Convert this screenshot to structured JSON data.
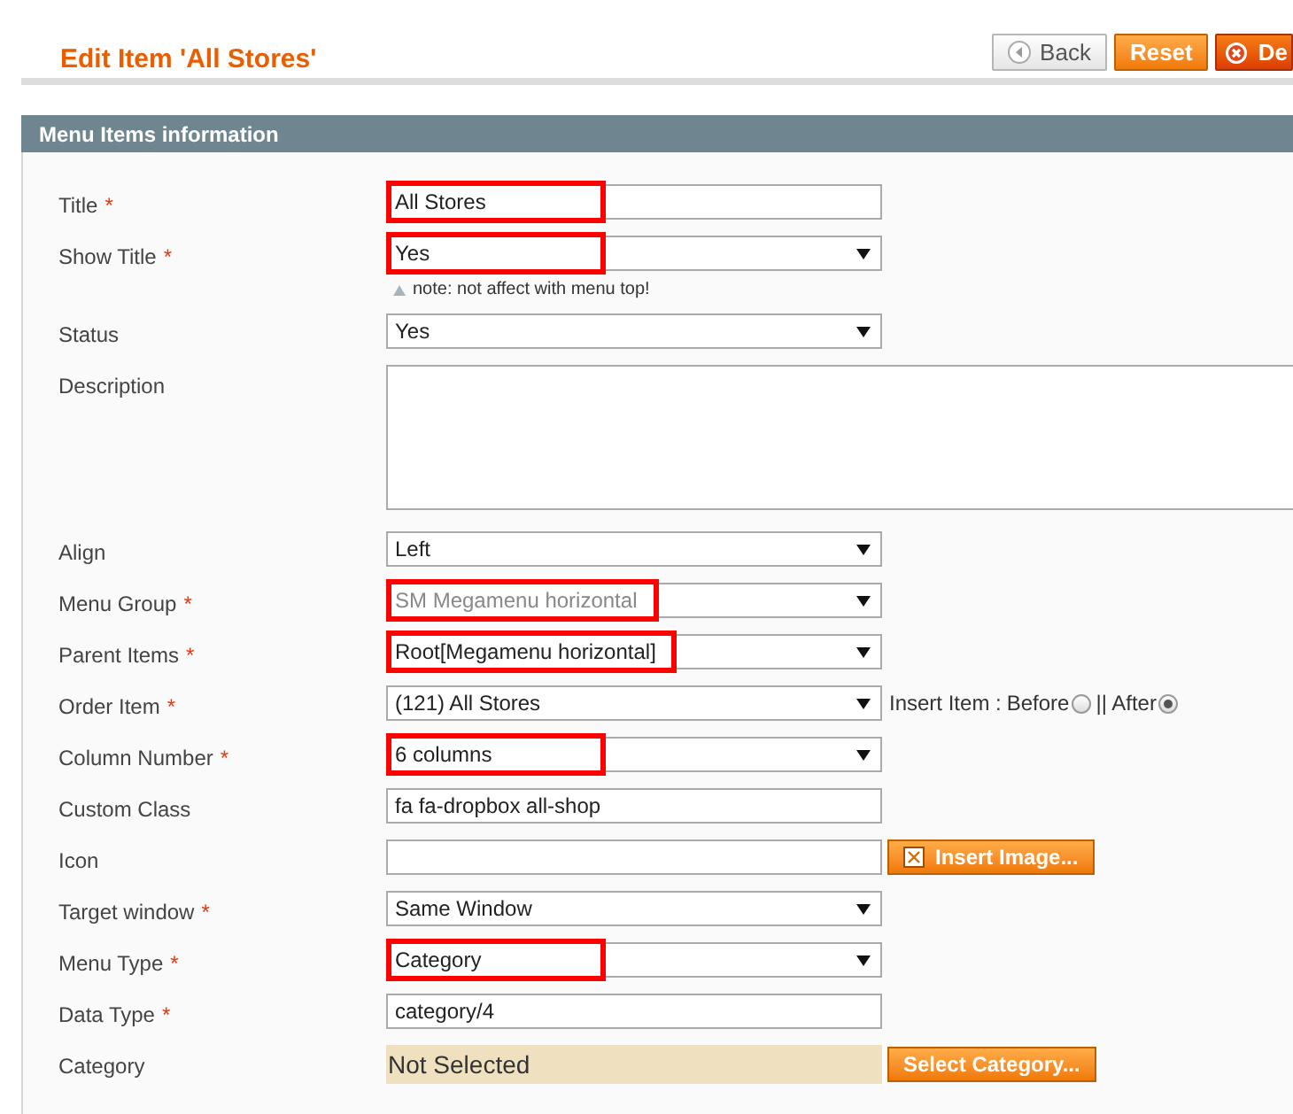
{
  "page_title": "Edit Item 'All Stores'",
  "buttons": [
    {
      "label": "Back",
      "kind": "back"
    },
    {
      "label": "Reset",
      "kind": "primary"
    },
    {
      "label": "De",
      "kind": "delete"
    }
  ],
  "section": {
    "title": "Menu Items information"
  },
  "fields": [
    {
      "kind": "text",
      "label": "Title",
      "mark": "*",
      "value": "All Stores",
      "highlighted": true
    },
    {
      "kind": "select",
      "label": "Show Title",
      "mark": "*",
      "value": "Yes",
      "highlighted": true,
      "note": "note: not affect with menu top!"
    },
    {
      "kind": "select",
      "label": "Status",
      "value": "Yes",
      "highlighted": false
    },
    {
      "kind": "textarea",
      "label": "Description"
    },
    {
      "kind": "select",
      "label": "Align",
      "value": "Left",
      "highlighted": false
    },
    {
      "kind": "select",
      "label": "Menu Group",
      "mark": "*",
      "value": "SM Megamenu horizontal",
      "highlighted": true,
      "disabled": true
    },
    {
      "kind": "select",
      "label": "Parent Items",
      "mark": "*",
      "value": "Root[Megamenu horizontal]",
      "highlighted": true
    },
    {
      "kind": "select",
      "label": "Order Item",
      "mark": "*",
      "value": "(121) All Stores",
      "highlighted": false,
      "insert": {
        "label": "Insert Item :",
        "options": [
          {
            "label": "Before",
            "selected": false
          },
          {
            "label": "|| After",
            "selected": true
          }
        ]
      }
    },
    {
      "kind": "select",
      "label": "Column Number",
      "mark": "*",
      "value": "6 columns",
      "highlighted": true
    },
    {
      "kind": "text",
      "label": "Custom Class",
      "value": "fa fa-dropbox all-shop",
      "highlighted": false
    },
    {
      "kind": "text",
      "label": "Icon",
      "button": "Insert Image..."
    },
    {
      "kind": "select",
      "label": "Target window",
      "mark": "*",
      "value": "Same Window",
      "highlighted": false
    },
    {
      "kind": "select",
      "label": "Menu Type",
      "mark": "*",
      "value": "Category",
      "highlighted": true
    },
    {
      "kind": "text",
      "label": "Data Type",
      "mark": "*",
      "value": "category/4",
      "highlighted": false
    },
    {
      "kind": "picker",
      "label": "Category",
      "value": "Not Selected",
      "button": "Select Category..."
    }
  ]
}
